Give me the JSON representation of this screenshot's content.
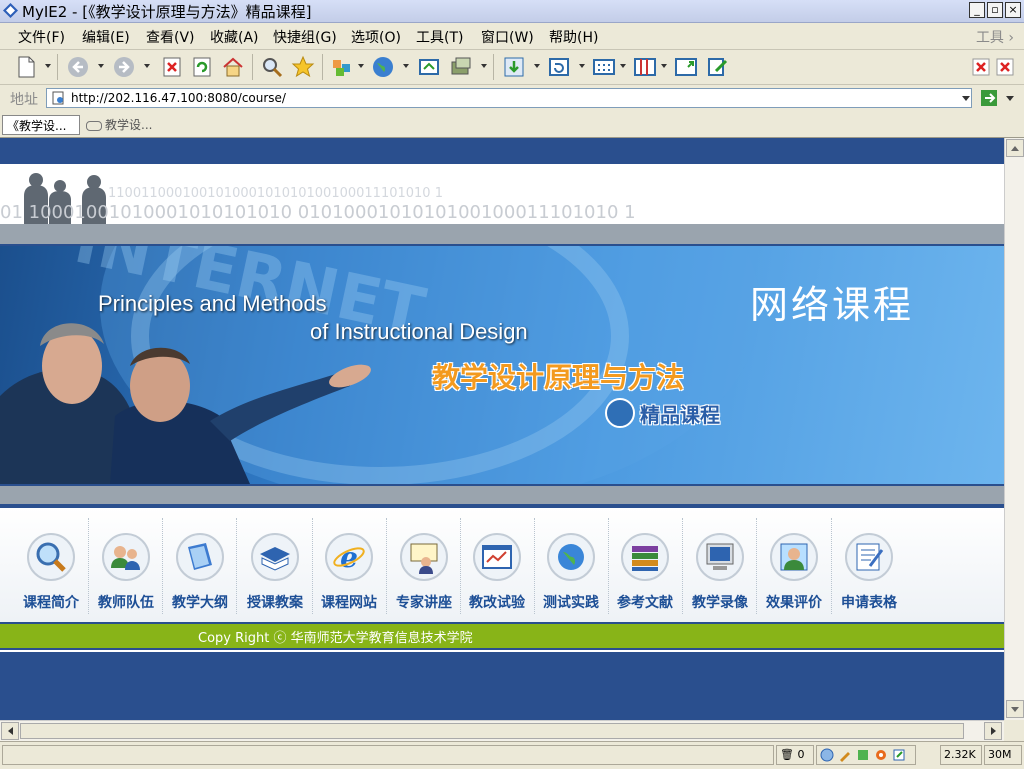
{
  "window": {
    "title": "MyIE2 - [《教学设计原理与方法》精品课程]",
    "buttons": [
      "_",
      "▫",
      "×"
    ]
  },
  "menu": {
    "items": [
      "文件(F)",
      "编辑(E)",
      "查看(V)",
      "收藏(A)",
      "快捷组(G)",
      "选项(O)",
      "工具(T)",
      "窗口(W)",
      "帮助(H)"
    ],
    "tools_label": "工具 ›"
  },
  "address": {
    "label": "地址",
    "url": "http://202.116.47.100:8080/course/"
  },
  "tabs": [
    {
      "label": "《教学设...",
      "active": true
    },
    {
      "label": "教学设...",
      "active": false
    }
  ],
  "page": {
    "binary_line1": "110011000100101000101010100100011101010 1",
    "binary_line2": "01 10001001010001010101010 0101000101010100100011101010 1",
    "banner_en_line1": "Principles and Methods",
    "banner_en_line2": "of Instructional Design",
    "banner_cn_title": "教学设计原理与方法",
    "banner_badge": "精品课程",
    "banner_right": "网络课程",
    "watermark_text": "INTERNET",
    "nav_items": [
      {
        "label": "课程简介",
        "icon": "magnifier-icon"
      },
      {
        "label": "教师队伍",
        "icon": "team-icon"
      },
      {
        "label": "教学大纲",
        "icon": "book-icon"
      },
      {
        "label": "授课教案",
        "icon": "notebook-icon"
      },
      {
        "label": "课程网站",
        "icon": "ie-logo-icon"
      },
      {
        "label": "专家讲座",
        "icon": "lecturer-icon"
      },
      {
        "label": "教改试验",
        "icon": "chart-window-icon"
      },
      {
        "label": "测试实践",
        "icon": "globe-icon"
      },
      {
        "label": "参考文献",
        "icon": "books-stack-icon"
      },
      {
        "label": "教学录像",
        "icon": "monitor-icon"
      },
      {
        "label": "效果评价",
        "icon": "user-rating-icon"
      },
      {
        "label": "申请表格",
        "icon": "form-pen-icon"
      }
    ],
    "copyright": "Copy Right ⓒ  华南师范大学教育信息技术学院"
  },
  "status": {
    "trash_count": "0",
    "size": "2.32K",
    "memory": "30M"
  },
  "colors": {
    "page_bg": "#2a4f8e",
    "nav_text": "#1d4f96",
    "copyright_bar": "#88b418",
    "banner_cn": "#f39a1f"
  }
}
